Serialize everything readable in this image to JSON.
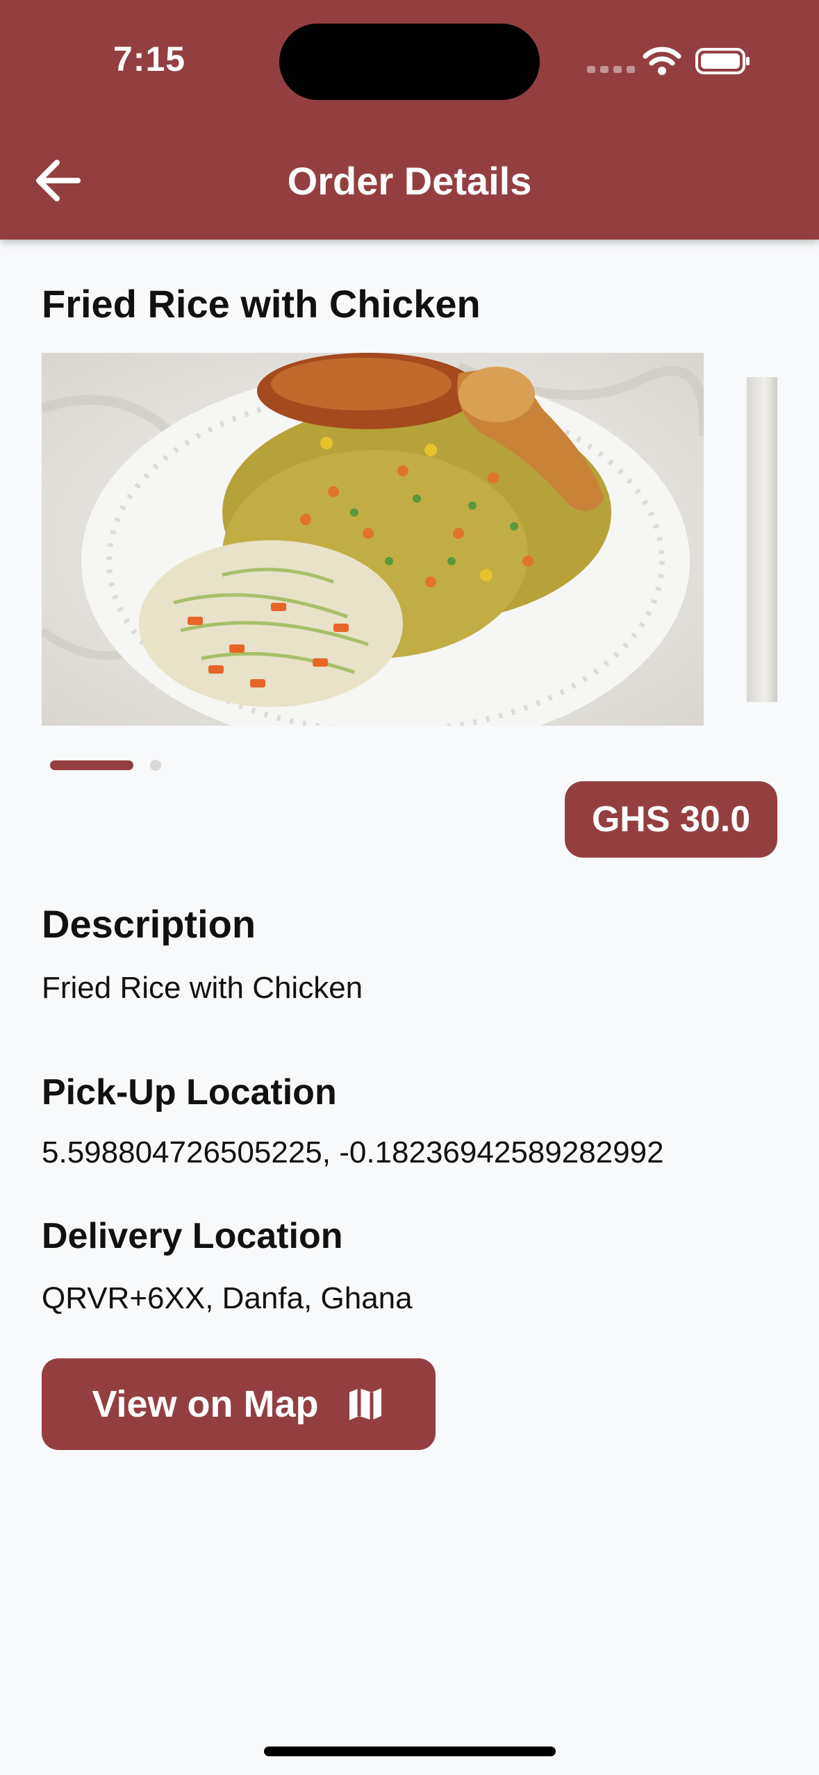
{
  "status_bar": {
    "time": "7:15"
  },
  "app_bar": {
    "title": "Order Details",
    "back_icon": "arrow-left-icon"
  },
  "item": {
    "title": "Fried Rice with Chicken",
    "image_alt": "Plate of fried rice with chicken and coleslaw"
  },
  "carousel": {
    "page_count": 2,
    "active_index": 0
  },
  "price": {
    "label": "GHS 30.0"
  },
  "description": {
    "heading": "Description",
    "text": "Fried Rice with Chicken"
  },
  "pickup": {
    "heading": "Pick-Up Location",
    "value": "5.598804726505225, -0.18236942589282992"
  },
  "delivery": {
    "heading": "Delivery Location",
    "value": "QRVR+6XX, Danfa, Ghana"
  },
  "map_button": {
    "label": "View on Map",
    "icon": "map-icon"
  },
  "colors": {
    "primary": "#933f42",
    "background": "#f8f9fb"
  }
}
